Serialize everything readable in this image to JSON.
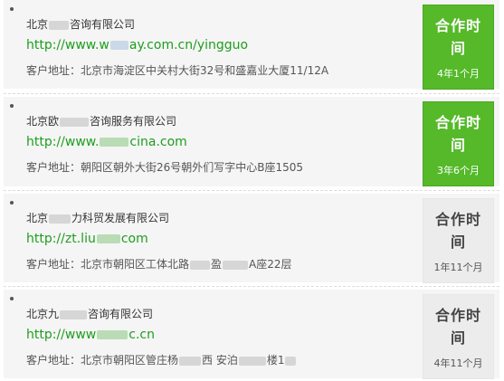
{
  "records": [
    {
      "company": [
        "北京",
        "咨询有限公司"
      ],
      "url": [
        "http://www.w",
        "ay.com.cn/yingguo"
      ],
      "address": [
        "客户地址：北京市海淀区中关村大街32号和盛嘉业大厦11/12A"
      ],
      "tag_title": "合作时间",
      "duration": "4年1个月",
      "highlight": true
    },
    {
      "company": [
        "北京欧",
        "咨询服务有限公司"
      ],
      "url": [
        "http://www.",
        "cina.com"
      ],
      "address": [
        "客户地址：朝阳区朝外大街26号朝外们写字中心B座1505"
      ],
      "tag_title": "合作时间",
      "duration": "3年6个月",
      "highlight": true
    },
    {
      "company": [
        "北京",
        "力科贸发展有限公司"
      ],
      "url": [
        "http://zt.liu",
        "com"
      ],
      "address": [
        "客户地址：北京市朝阳区工体北路",
        "盈",
        "A座22层"
      ],
      "tag_title": "合作时间",
      "duration": "1年11个月",
      "highlight": false
    },
    {
      "company": [
        "北京九",
        "咨询有限公司"
      ],
      "url": [
        "http://www",
        "c.cn"
      ],
      "address": [
        "客户地址：北京市朝阳区管庄杨",
        "西 安泊",
        "楼1"
      ],
      "tag_title": "合作时间",
      "duration": "4年11个月",
      "highlight": false
    }
  ],
  "colors": {
    "accent_green": "#55b929",
    "link_green": "#1e9e1e",
    "card_bg": "#f5f5f5",
    "tag_gray": "#ececec"
  }
}
